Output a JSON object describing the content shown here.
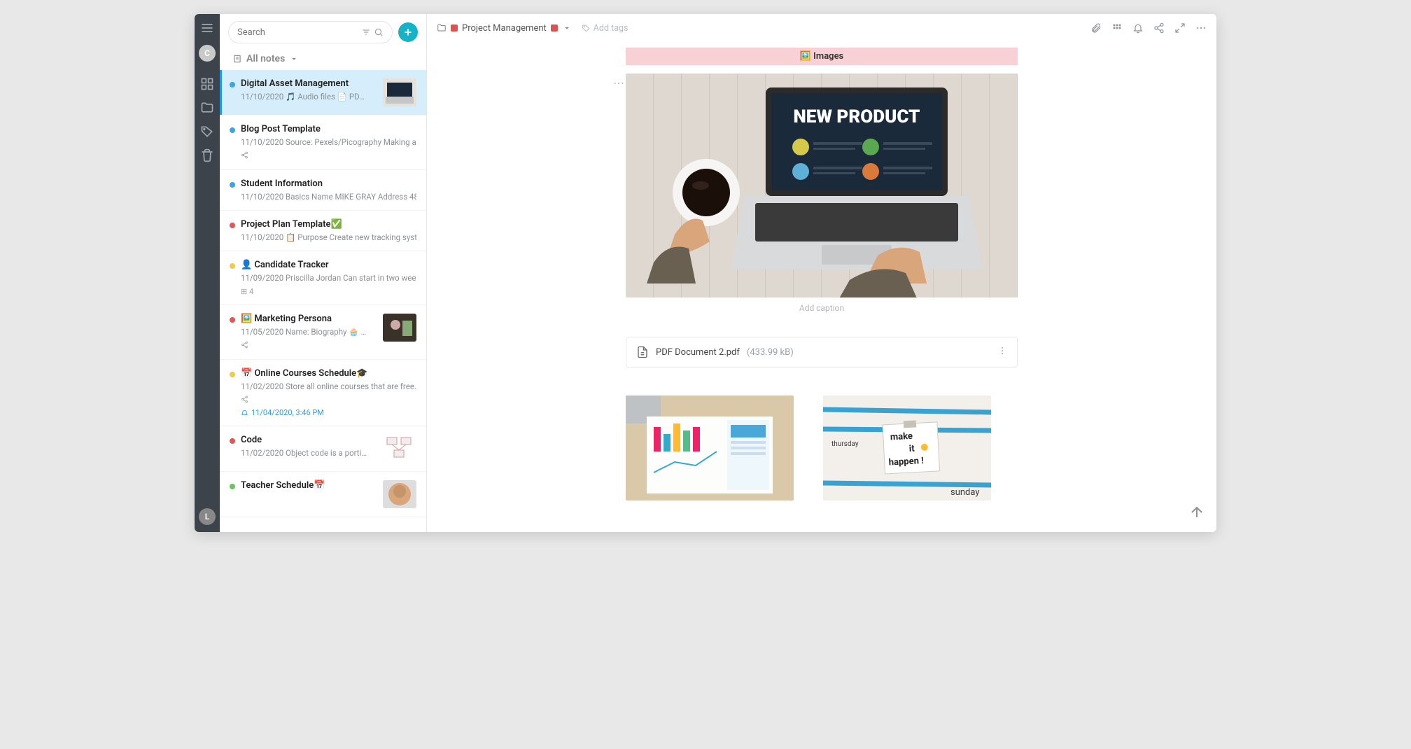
{
  "user_initial": "C",
  "bottom_user_initial": "L",
  "search_placeholder": "Search",
  "notes_section_label": "All notes",
  "dot_colors": {
    "blue": "#3aa5e6",
    "red": "#e25656",
    "yellow": "#f3c94b",
    "green": "#6ac261"
  },
  "notes": [
    {
      "title": "Digital Asset Management",
      "date": "11/10/2020",
      "snippet_icon1": "🎵",
      "snippet1": "Audio files",
      "snippet_icon2": "📄",
      "snippet2": "PD…",
      "dot": "blue",
      "has_thumb": true,
      "selected": true
    },
    {
      "title": "Blog Post Template",
      "date": "11/10/2020",
      "snippet1": "Source: Pexels/Picography Making a …",
      "dot": "blue",
      "share": true
    },
    {
      "title": "Student Information",
      "date": "11/10/2020",
      "snippet1": "Basics Name MIKE GRAY Address 48…",
      "dot": "blue"
    },
    {
      "title": "Project Plan Template",
      "title_suffix": "✅",
      "date": "11/10/2020",
      "snippet_icon1": "📋",
      "snippet1": "Purpose",
      "snippet2": "Create new tracking syst…",
      "dot": "red"
    },
    {
      "title_prefix": "👤",
      "title": "Candidate Tracker",
      "date": "11/09/2020",
      "snippet1": "Priscilla Jordan Can start in two wee…",
      "sub_icon": "⊞",
      "sub_text": "4",
      "dot": "yellow"
    },
    {
      "title_prefix": "🖼️",
      "title": "Marketing Persona",
      "date": "11/05/2020",
      "snippet1": "Name: Biography 🧁 …",
      "dot": "red",
      "has_thumb": true,
      "share": true
    },
    {
      "title_prefix": "📅",
      "title": "Online Courses Schedule",
      "title_suffix": "🎓",
      "date": "11/02/2020",
      "snippet1": "Store all online courses that are free…",
      "share": true,
      "reminder": "11/04/2020, 3:46 PM",
      "dot": "yellow"
    },
    {
      "title": "Code",
      "date": "11/02/2020",
      "snippet1": "Object code is a porti…",
      "dot": "red",
      "has_thumb": true
    },
    {
      "title": "Teacher Schedule",
      "title_suffix": "📅",
      "dot": "green",
      "has_thumb": true
    }
  ],
  "breadcrumb": {
    "folder": "Project Management",
    "folder_color_after": "🟥"
  },
  "add_tags_label": "Add tags",
  "banner": {
    "icon": "🖼️",
    "label": "Images"
  },
  "hero_image_text": "NEW PRODUCT",
  "caption_placeholder": "Add caption",
  "pdf": {
    "name": "PDF Document 2.pdf",
    "size": "(433.99 kB)"
  }
}
